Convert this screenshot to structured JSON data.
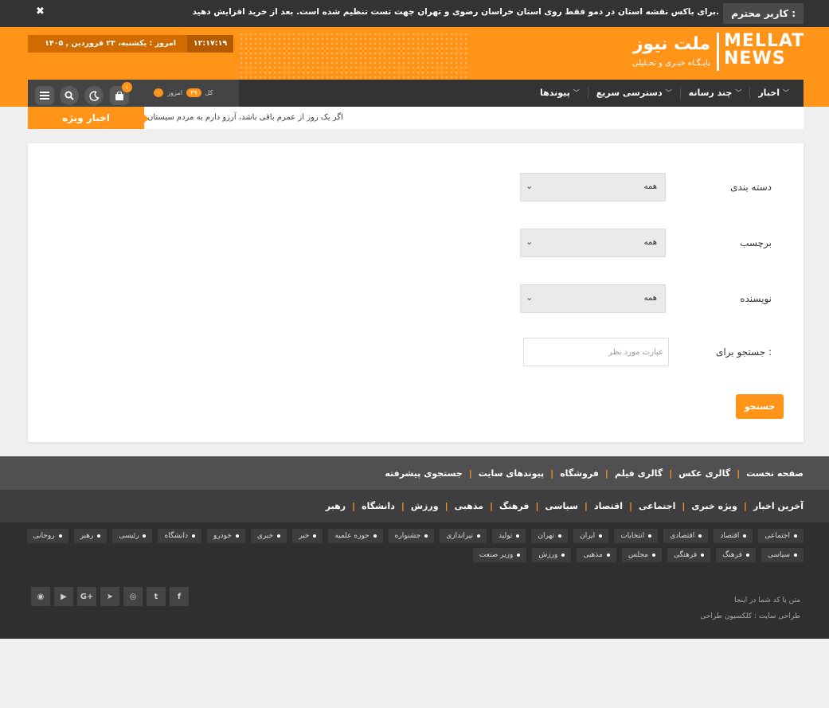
{
  "topbar": {
    "badge": "کاربر محترم :",
    "message": "برای باکس نقشه استان در دمو فقط روی استان خراسان رضوی و تهران جهت تست تنظیم شده است. بعد از خرید افزایش دهید.",
    "close": "✖"
  },
  "header": {
    "time": "۱۲:۱۷:۱۹",
    "date": "امروز : یکشنبه، ۲۳ فروردین , ۱۴۰۵",
    "logo_en_line1": "MELLAT",
    "logo_en_line2": "NEWS",
    "logo_fa": "ملت نیوز",
    "logo_sub": "پایـگـاه خبـری و تحـلیلی"
  },
  "nav": {
    "items": [
      {
        "label": "اخبار"
      },
      {
        "label": "چند رسانه"
      },
      {
        "label": "دسترسی سریع"
      },
      {
        "label": "پیوندها"
      }
    ]
  },
  "tools": {
    "total_label": "کل",
    "total_value": "۳۹",
    "today_label": "امروز",
    "today_value": "۰",
    "cart_count": "۱",
    "icons": [
      "menu-icon",
      "search-icon",
      "moon-icon",
      "cart-icon"
    ]
  },
  "ticker": {
    "label": "اخبار ویژه",
    "headline": "اگر یک روز از عمرم باقی باشد، آرزو دارم به مردم سیستان"
  },
  "search_form": {
    "category_label": "دسته بندی",
    "category_value": "همه",
    "tag_label": "برچسب",
    "tag_value": "همه",
    "author_label": "نویسنده",
    "author_value": "همه",
    "query_label": "جستجو برای :",
    "query_placeholder": "عبارت مورد نظر",
    "submit": "جستجو"
  },
  "footer_links_1": [
    "صفحه نخست",
    "گالری عکس",
    "گالری فیلم",
    "فروشگاه",
    "پیوندهای سایت",
    "جستجوی پیشرفته"
  ],
  "footer_links_2": [
    "آخرین اخبار",
    "ویژه خبری",
    "اجتماعی",
    "اقتصاد",
    "سیاسی",
    "فرهنگ",
    "مذهبی",
    "ورزش",
    "دانشگاه",
    "رهبر"
  ],
  "tags": [
    "اجتماعی",
    "اقتصاد",
    "اقتصادی",
    "انتخابات",
    "ایران",
    "تهران",
    "تولید",
    "تیراندازی",
    "جشنواره",
    "حوزه علمیه",
    "خبر",
    "خبری",
    "خودرو",
    "دانشگاه",
    "رئیسی",
    "رهبر",
    "روحانی",
    "سیاسی",
    "فرهنگ",
    "فرهنگی",
    "مجلس",
    "مذهبی",
    "ورزش",
    "وزیر صنعت"
  ],
  "credits": {
    "line1": "متن یا کد شما در اینجا",
    "line2": "طراحی سایت : کلکسیون طراحی"
  },
  "social": [
    "facebook-icon",
    "twitter-icon",
    "instagram-icon",
    "telegram-icon",
    "google-plus-icon",
    "youtube-icon",
    "rss-icon"
  ]
}
